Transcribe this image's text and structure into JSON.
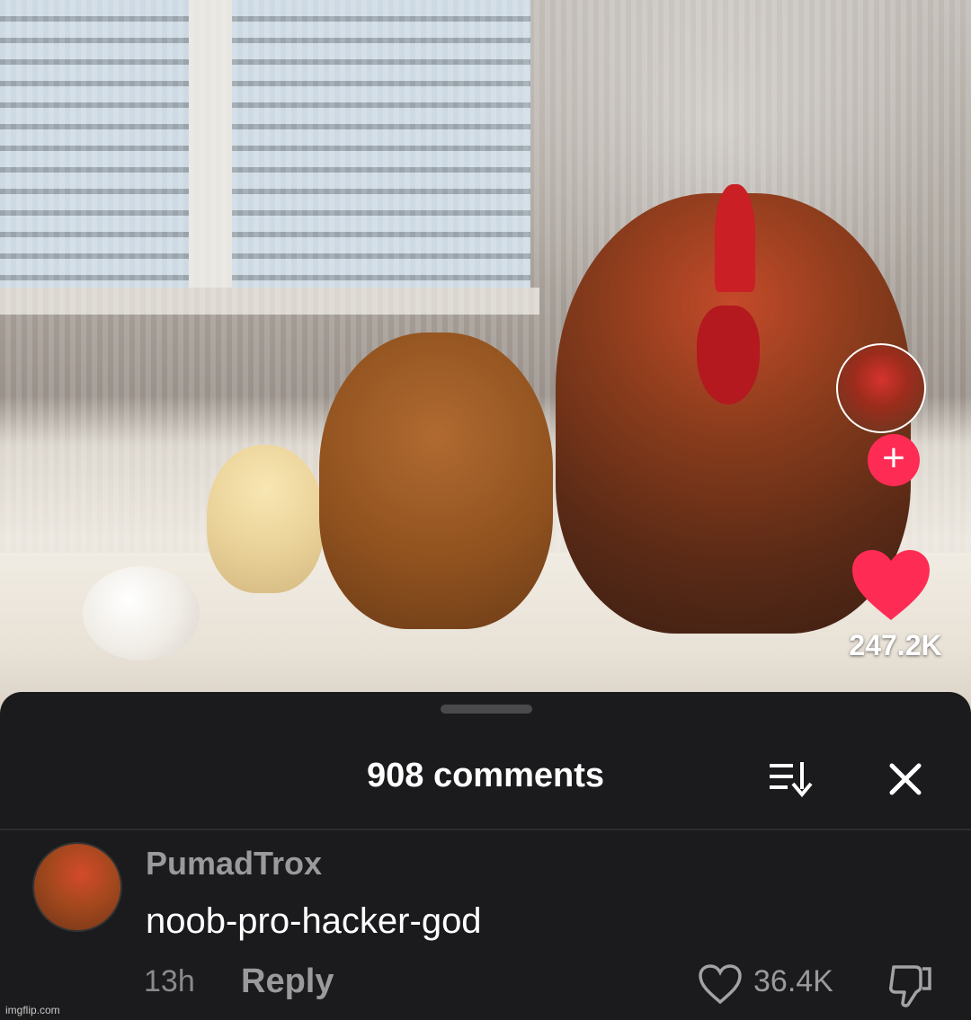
{
  "video": {
    "like_count": "247.2K",
    "accent_color": "#fe2c55"
  },
  "comments_sheet": {
    "title": "908 comments",
    "sort_icon": "sort-icon",
    "close_icon": "close-icon"
  },
  "comment": {
    "username": "PumadTrox",
    "text": "noob-pro-hacker-god",
    "time": "13h",
    "reply_label": "Reply",
    "like_count": "36.4K"
  },
  "watermark": "imgflip.com"
}
